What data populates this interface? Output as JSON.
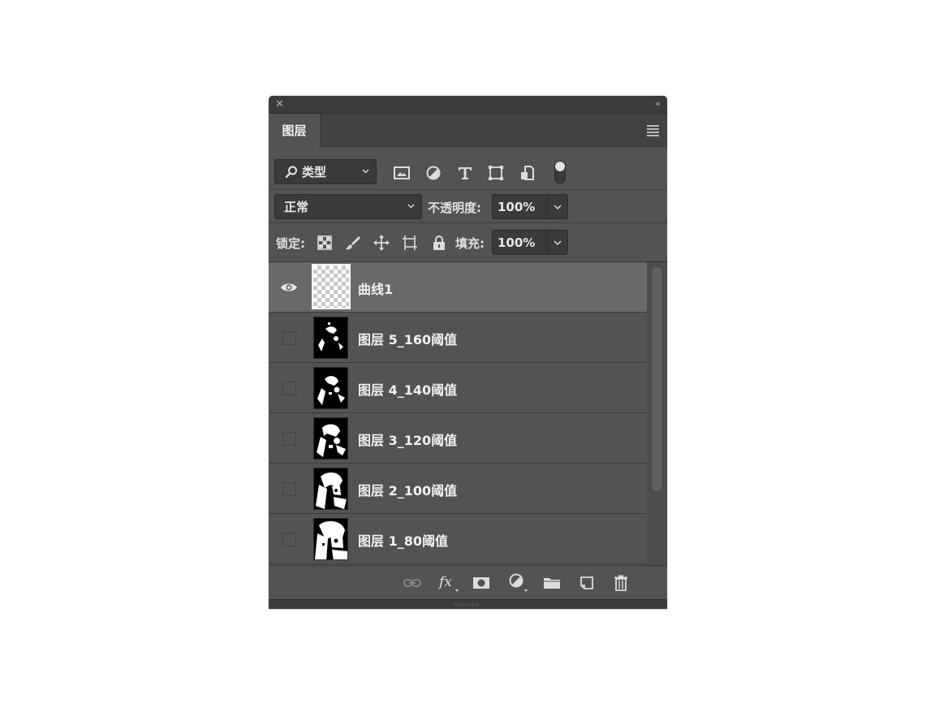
{
  "panel": {
    "tab_label": "图层",
    "filter": {
      "selected": "类型",
      "icons": [
        "image-filter-icon",
        "adjustment-filter-icon",
        "text-filter-icon",
        "shape-filter-icon",
        "smart-object-filter-icon",
        "filter-toggle-icon"
      ]
    },
    "blend_mode": "正常",
    "opacity_label": "不透明度:",
    "opacity_value": "100%",
    "lock_label": "锁定:",
    "lock_icons": [
      "lock-transparent-icon",
      "lock-pixels-icon",
      "lock-position-icon",
      "lock-artboard-icon",
      "lock-all-icon"
    ],
    "fill_label": "填充:",
    "fill_value": "100%"
  },
  "layers": [
    {
      "name": "曲线1",
      "visible": true,
      "selected": true,
      "thumbnail": "transparent"
    },
    {
      "name": "图层 5_160阈值",
      "visible": false,
      "selected": false,
      "thumbnail": "threshold"
    },
    {
      "name": "图层 4_140阈值",
      "visible": false,
      "selected": false,
      "thumbnail": "threshold"
    },
    {
      "name": "图层 3_120阈值",
      "visible": false,
      "selected": false,
      "thumbnail": "threshold"
    },
    {
      "name": "图层 2_100阈值",
      "visible": false,
      "selected": false,
      "thumbnail": "threshold"
    },
    {
      "name": "图层 1_80阈值",
      "visible": false,
      "selected": false,
      "thumbnail": "threshold"
    }
  ],
  "bottom_icons": [
    "link-icon",
    "fx-icon",
    "mask-icon",
    "adjustment-icon",
    "folder-icon",
    "new-layer-icon",
    "trash-icon"
  ]
}
